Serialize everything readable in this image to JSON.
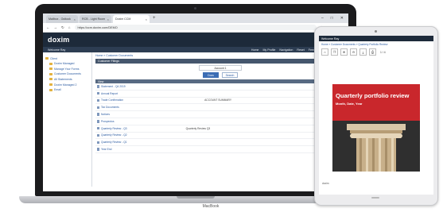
{
  "browser": {
    "tabs": [
      {
        "label": "Mailbox - Outlook"
      },
      {
        "label": "RCB - Light Room"
      },
      {
        "label": "Doxim CCM",
        "active": true
      }
    ],
    "new_tab": "+",
    "window_controls": [
      "–",
      "□",
      "✕"
    ],
    "url": "https://ccm.doxim.com/DEMO"
  },
  "app": {
    "logo": "doxim",
    "user_label": "Welcome Ray",
    "header_links": [
      "Home",
      "My Profile",
      "Navigation",
      "Reset",
      "Feedback",
      "Help",
      "Logout"
    ],
    "sidebar": [
      {
        "label": "Client",
        "child": false
      },
      {
        "label": "Doxim Managed",
        "child": true
      },
      {
        "label": "Manage Your Forms",
        "child": true
      },
      {
        "label": "Customer Documents",
        "child": true
      },
      {
        "label": "All Statements",
        "child": true
      },
      {
        "label": "Doxim Managed 2",
        "child": true
      },
      {
        "label": "Email",
        "child": true
      }
    ],
    "breadcrumb": "Home » Customer Documents",
    "panel_title": "Customer Filings",
    "account_label": "Account 1",
    "toggles": [
      {
        "label": "Docs",
        "on": true
      },
      {
        "label": "Search",
        "on": false
      }
    ],
    "list_header": "View",
    "rows": [
      {
        "label": "Statement - Q4 2019",
        "extra": ""
      },
      {
        "label": "Annual Report",
        "extra": ""
      },
      {
        "label": "Trade Confirmation",
        "extra": "ACCOUNT SUMMARY"
      },
      {
        "label": "Tax Documents",
        "extra": ""
      },
      {
        "label": "Notices",
        "extra": ""
      },
      {
        "label": "Prospectus",
        "extra": ""
      },
      {
        "label": "Quarterly Review - Q3",
        "extra": "Quarterly Review Q3"
      },
      {
        "label": "Quarterly Review - Q2",
        "extra": ""
      },
      {
        "label": "Quarterly Review - Q1",
        "extra": ""
      },
      {
        "label": "Year End",
        "extra": ""
      }
    ]
  },
  "laptop_label": "MacBook",
  "tablet": {
    "header": "Welcome Ray",
    "breadcrumb": "Home » Customer Documents » Quarterly Portfolio Review",
    "toolbar": [
      "⌂",
      "❐",
      "⊕",
      "⊖",
      "⤓",
      "⎙"
    ],
    "page_indicator": "1 / 4",
    "cover_title": "Quarterly portfolio review",
    "cover_subtitle": "Month, Date, Year",
    "footer": "doxim"
  },
  "colors": {
    "header": "#1d2a3a",
    "accent_red": "#c9272c",
    "link": "#2a5aa0"
  }
}
